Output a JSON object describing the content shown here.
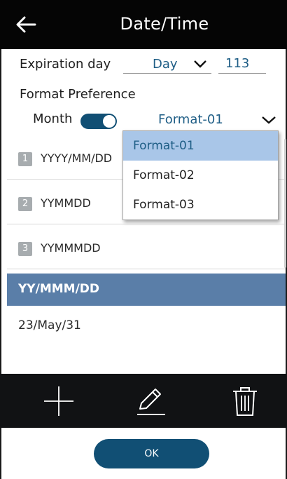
{
  "header": {
    "title": "Date/Time"
  },
  "expiration": {
    "label": "Expiration day",
    "unit_value": "Day",
    "number_value": "113"
  },
  "format_pref": {
    "label": "Format Preference",
    "toggle_label": "Month",
    "toggle_on": true,
    "selected_format": "Format-01"
  },
  "formats": [
    {
      "index": "1",
      "pattern": "YYYY/MM/DD"
    },
    {
      "index": "2",
      "pattern": "YYMMDD"
    },
    {
      "index": "3",
      "pattern": "YYMMMDD"
    }
  ],
  "selected": {
    "pattern": "YY/MMM/DD",
    "sample": "23/May/31"
  },
  "dropdown": {
    "options": [
      "Format-01",
      "Format-02",
      "Format-03"
    ],
    "active": "Format-01"
  },
  "ok_label": "OK",
  "colors": {
    "accent": "#114f74",
    "selected_bar": "#5a7ea8",
    "dropdown_active": "#a9c6e8"
  }
}
